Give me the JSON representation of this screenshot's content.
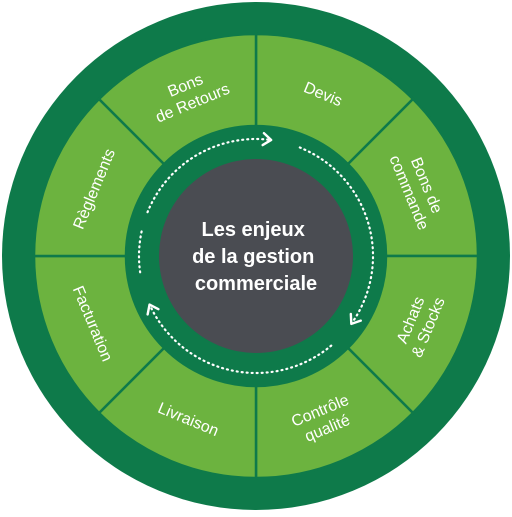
{
  "center": {
    "lines": [
      "Les enjeux",
      "de la gestion",
      "commerciale"
    ]
  },
  "segments": [
    {
      "id": "devis",
      "lines": [
        "Devis"
      ]
    },
    {
      "id": "bons-de-commande",
      "lines": [
        "Bons de",
        "commande"
      ]
    },
    {
      "id": "achats-stocks",
      "lines": [
        "Achats",
        "& Stocks"
      ]
    },
    {
      "id": "controle-qualite",
      "lines": [
        "Contrôle",
        "qualité"
      ]
    },
    {
      "id": "livraison",
      "lines": [
        "Livraison"
      ]
    },
    {
      "id": "facturation",
      "lines": [
        "Facturation"
      ]
    },
    {
      "id": "reglements",
      "lines": [
        "Règlements"
      ]
    },
    {
      "id": "bons-de-retours",
      "lines": [
        "Bons",
        "de Retours"
      ]
    }
  ],
  "colors": {
    "outer_ring": "#0e7a4a",
    "segment": "#6cb33f",
    "segment_divider": "#0e7a4a",
    "inner_ring": "#0e7a4a",
    "center": "#4a4c52",
    "arrows": "#ffffff",
    "text": "#ffffff"
  },
  "flow": {
    "direction": "clockwise",
    "arrow_style": "dotted"
  }
}
